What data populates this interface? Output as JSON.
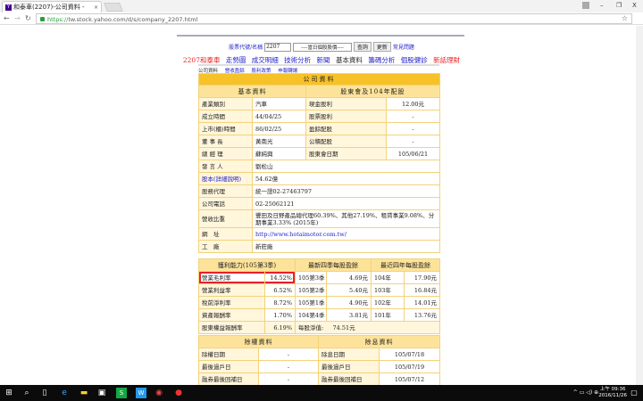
{
  "browser": {
    "tab_title": "和泰車(2207)-公司資料 -",
    "url_scheme": "https://",
    "url_rest": "tw.stock.yahoo.com/d/s/company_2207.html"
  },
  "search": {
    "label": "股票代號/名稱",
    "value": "2207",
    "select": "----當日個股股價----",
    "query": "查詢",
    "update": "更新",
    "faq": "常見問題"
  },
  "links": {
    "stock": "2207和泰車",
    "items": [
      "走勢圖",
      "成交明細",
      "技術分析",
      "新聞",
      "基本資料",
      "籌碼分析",
      "個股健診"
    ],
    "finance": "新話理財"
  },
  "subnav": [
    "公司資料",
    "營收盈餘",
    "股利政策",
    "申報轉讓"
  ],
  "company": {
    "title": "公司資料",
    "basic_header": "基本資料",
    "div_header": "股東會及104年配股",
    "rows": [
      {
        "l": "產業類別",
        "v": "汽車",
        "l2": "現金股利",
        "v2": "12.00元"
      },
      {
        "l": "成立時間",
        "v": "44/04/25",
        "l2": "股票股利",
        "v2": "-"
      },
      {
        "l": "上市(櫃)時間",
        "v": "86/02/25",
        "l2": "盈餘配股",
        "v2": "-"
      },
      {
        "l": "董 事 長",
        "v": "黃南光",
        "l2": "公積配股",
        "v2": "-"
      },
      {
        "l": "總 經 理",
        "v": "蘇純興",
        "l2": "股東會日期",
        "v2": "105/06/21"
      }
    ],
    "spokesman_l": "發 言 人",
    "spokesman": "劉松山",
    "capital_l": "股本(詳細說明)",
    "capital": "54.62億",
    "agent_l": "股務代理",
    "agent": "統一證02-27463797",
    "phone_l": "公司電話",
    "phone": "02-25062121",
    "revenue_l": "營收比重",
    "revenue": "豐田及日野產品總代理60.39%、其他27.19%、租賃事業9.08%、分期事業3.33% (2015年)",
    "web_l": "網　址",
    "web": "http://www.hotaimotor.com.tw/",
    "factory_l": "工　廠",
    "factory": "新莊廠"
  },
  "profit": {
    "h1": "獲利能力(105第3季)",
    "h2": "最新四季每股盈餘",
    "h3": "最近四年每股盈餘",
    "rows": [
      {
        "a": "營業毛利率",
        "av": "14.52%",
        "b": "105第3季",
        "bv": "4.69元",
        "c": "104年",
        "cv": "17.90元"
      },
      {
        "a": "營業利益率",
        "av": "6.52%",
        "b": "105第2季",
        "bv": "5.40元",
        "c": "103年",
        "cv": "16.84元"
      },
      {
        "a": "稅前淨利率",
        "av": "8.72%",
        "b": "105第1季",
        "bv": "4.90元",
        "c": "102年",
        "cv": "14.01元"
      },
      {
        "a": "資產報酬率",
        "av": "1.70%",
        "b": "104第4季",
        "bv": "3.81元",
        "c": "101年",
        "cv": "13.76元"
      }
    ],
    "last": {
      "a": "股東權益報酬率",
      "av": "6.19%",
      "b": "每股淨值:",
      "bv": "74.51元"
    }
  },
  "exdiv": {
    "h1": "除權資料",
    "h2": "除息資料",
    "rows": [
      {
        "a": "除權日期",
        "av": "-",
        "b": "除息日期",
        "bv": "105/07/18"
      },
      {
        "a": "最後過戶日",
        "av": "-",
        "b": "最後過戶日",
        "bv": "105/07/19"
      },
      {
        "a": "融券最後回補日",
        "av": "-",
        "b": "融券最後回補日",
        "bv": "105/07/12"
      }
    ]
  },
  "taskbar": {
    "time": "上午 09:36",
    "date": "2016/11/26"
  }
}
